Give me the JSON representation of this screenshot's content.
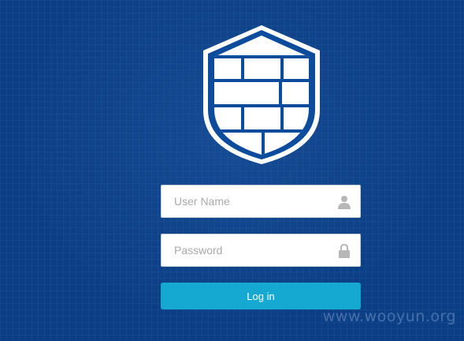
{
  "login_form": {
    "username_placeholder": "User Name",
    "password_placeholder": "Password",
    "login_label": "Log in"
  },
  "icons": {
    "logo": "firewall-shield-icon",
    "username": "user-icon",
    "password": "lock-icon"
  },
  "watermark": "www.wooyun.org",
  "colors": {
    "background": "#0b3f85",
    "shield_blue": "#0d4c9c",
    "button": "#15a8d0",
    "field_icon": "#b7b7b7"
  }
}
